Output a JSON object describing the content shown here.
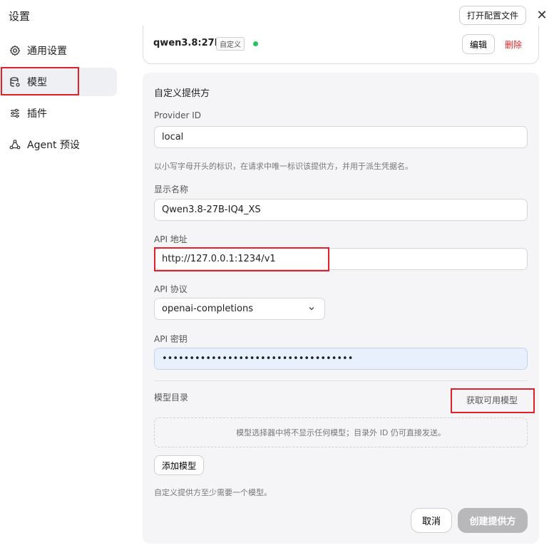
{
  "window": {
    "title": "设置",
    "open_config_label": "打开配置文件",
    "close_glyph": "✕"
  },
  "sidebar": {
    "items": [
      {
        "label": "通用设置",
        "icon": "gear-icon"
      },
      {
        "label": "模型",
        "icon": "database-icon",
        "active": true
      },
      {
        "label": "插件",
        "icon": "sliders-icon"
      },
      {
        "label": "Agent 预设",
        "icon": "agent-icon"
      }
    ]
  },
  "provider_card": {
    "name": "qwen3.8:27b",
    "tag": "自定义",
    "status_color": "#22c55e",
    "edit_label": "编辑",
    "delete_label": "删除"
  },
  "form": {
    "section_title": "自定义提供方",
    "provider_id": {
      "label": "Provider ID",
      "value": "local",
      "help": "以小写字母开头的标识，在请求中唯一标识该提供方，并用于派生凭据名。"
    },
    "display_name": {
      "label": "显示名称",
      "value": "Qwen3.8-27B-IQ4_XS"
    },
    "api_url": {
      "label": "API 地址",
      "value": "http://127.0.0.1:1234/v1"
    },
    "api_protocol": {
      "label": "API 协议",
      "value": "openai-completions"
    },
    "api_key": {
      "label": "API 密钥",
      "value": "•••••••••••••••••••••••••••••••••••"
    },
    "model_catalog": {
      "label": "模型目录",
      "fetch_label": "获取可用模型",
      "empty_text": "模型选择器中将不显示任何模型；目录外 ID 仍可直接发送。",
      "add_label": "添加模型",
      "help": "自定义提供方至少需要一个模型。"
    },
    "cancel_label": "取消",
    "create_label": "创建提供方"
  },
  "colors": {
    "highlight": "#e0212b",
    "danger": "#e02424",
    "panel_bg": "#f5f5f7"
  }
}
